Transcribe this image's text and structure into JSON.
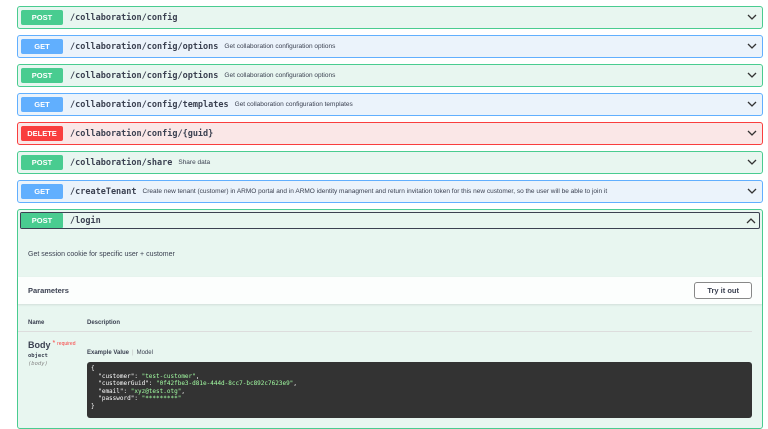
{
  "operations": [
    {
      "method": "POST",
      "path": "/collaboration/config",
      "desc": ""
    },
    {
      "method": "GET",
      "path": "/collaboration/config/options",
      "desc": "Get collaboration configuration options"
    },
    {
      "method": "POST",
      "path": "/collaboration/config/options",
      "desc": "Get collaboration configuration options"
    },
    {
      "method": "GET",
      "path": "/collaboration/config/templates",
      "desc": "Get collaboration configuration templates"
    },
    {
      "method": "DELETE",
      "path": "/collaboration/config/{guid}",
      "desc": ""
    },
    {
      "method": "POST",
      "path": "/collaboration/share",
      "desc": "Share data"
    },
    {
      "method": "GET",
      "path": "/createTenant",
      "desc": "Create new tenant (customer) in ARMO portal and in ARMO identity managment and return invitation token for this new customer, so the user will be able to join it"
    }
  ],
  "login": {
    "method": "POST",
    "path": "/login",
    "summary": "Get session cookie for specific user + customer",
    "parameters_title": "Parameters",
    "try_label": "Try it out",
    "col_name": "Name",
    "col_desc": "Description",
    "param": {
      "name": "Body",
      "required": "required",
      "type": "object",
      "in": "(body)"
    },
    "example_label": "Example Value",
    "model_label": "Model",
    "example": {
      "customer": "\"test-customer\"",
      "customerGuid": "\"0f42fbe3-d81e-444d-8cc7-bc892c7623e9\"",
      "email": "\"xyz@test.otg\"",
      "password": "\"*********\""
    }
  }
}
